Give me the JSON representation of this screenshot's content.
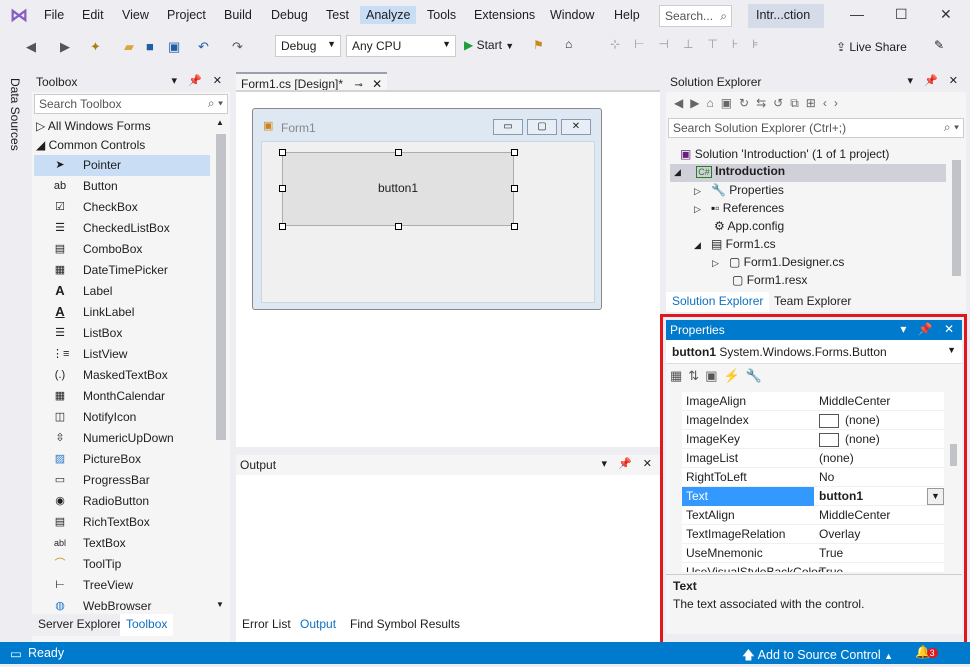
{
  "menu": {
    "items": [
      "File",
      "Edit",
      "View",
      "Project",
      "Build",
      "Debug",
      "Test",
      "Analyze",
      "Tools",
      "Extensions",
      "Window",
      "Help"
    ],
    "search": "Search...",
    "solution_title": "Intr...ction"
  },
  "toolbar": {
    "config": "Debug",
    "platform": "Any CPU",
    "start": "Start",
    "live_share": "Live Share"
  },
  "side_strip": "Data Sources",
  "toolbox": {
    "title": "Toolbox",
    "search_placeholder": "Search Toolbox",
    "groups": [
      "All Windows Forms",
      "Common Controls"
    ],
    "items": [
      "Pointer",
      "Button",
      "CheckBox",
      "CheckedListBox",
      "ComboBox",
      "DateTimePicker",
      "Label",
      "LinkLabel",
      "ListBox",
      "ListView",
      "MaskedTextBox",
      "MonthCalendar",
      "NotifyIcon",
      "NumericUpDown",
      "PictureBox",
      "ProgressBar",
      "RadioButton",
      "RichTextBox",
      "TextBox",
      "ToolTip",
      "TreeView",
      "WebBrowser"
    ],
    "tabs": [
      "Server Explorer",
      "Toolbox"
    ]
  },
  "designer": {
    "tab": "Form1.cs [Design]*",
    "form_title": "Form1",
    "button_text": "button1"
  },
  "output": {
    "title": "Output",
    "tabs": [
      "Error List",
      "Output",
      "Find Symbol Results"
    ]
  },
  "solution_explorer": {
    "title": "Solution Explorer",
    "search_placeholder": "Search Solution Explorer (Ctrl+;)",
    "tree": [
      "Solution 'Introduction' (1 of 1 project)",
      "Introduction",
      "Properties",
      "References",
      "App.config",
      "Form1.cs",
      "Form1.Designer.cs",
      "Form1.resx"
    ],
    "tabs": [
      "Solution Explorer",
      "Team Explorer"
    ]
  },
  "properties": {
    "title": "Properties",
    "object_name": "button1",
    "object_type": "System.Windows.Forms.Button",
    "rows": [
      {
        "name": "ImageAlign",
        "value": "MiddleCenter"
      },
      {
        "name": "ImageIndex",
        "value": "(none)"
      },
      {
        "name": "ImageKey",
        "value": "(none)"
      },
      {
        "name": "ImageList",
        "value": "(none)"
      },
      {
        "name": "RightToLeft",
        "value": "No"
      },
      {
        "name": "Text",
        "value": "button1"
      },
      {
        "name": "TextAlign",
        "value": "MiddleCenter"
      },
      {
        "name": "TextImageRelation",
        "value": "Overlay"
      },
      {
        "name": "UseMnemonic",
        "value": "True"
      },
      {
        "name": "UseVisualStyleBackColor",
        "value": "True"
      }
    ],
    "desc_title": "Text",
    "desc_text": "The text associated with the control."
  },
  "status": {
    "ready": "Ready",
    "source_control": "Add to Source Control",
    "notifications": "3"
  },
  "colors": {
    "accent": "#007acc",
    "highlight": "#e2171e",
    "selection": "#3399ff"
  }
}
